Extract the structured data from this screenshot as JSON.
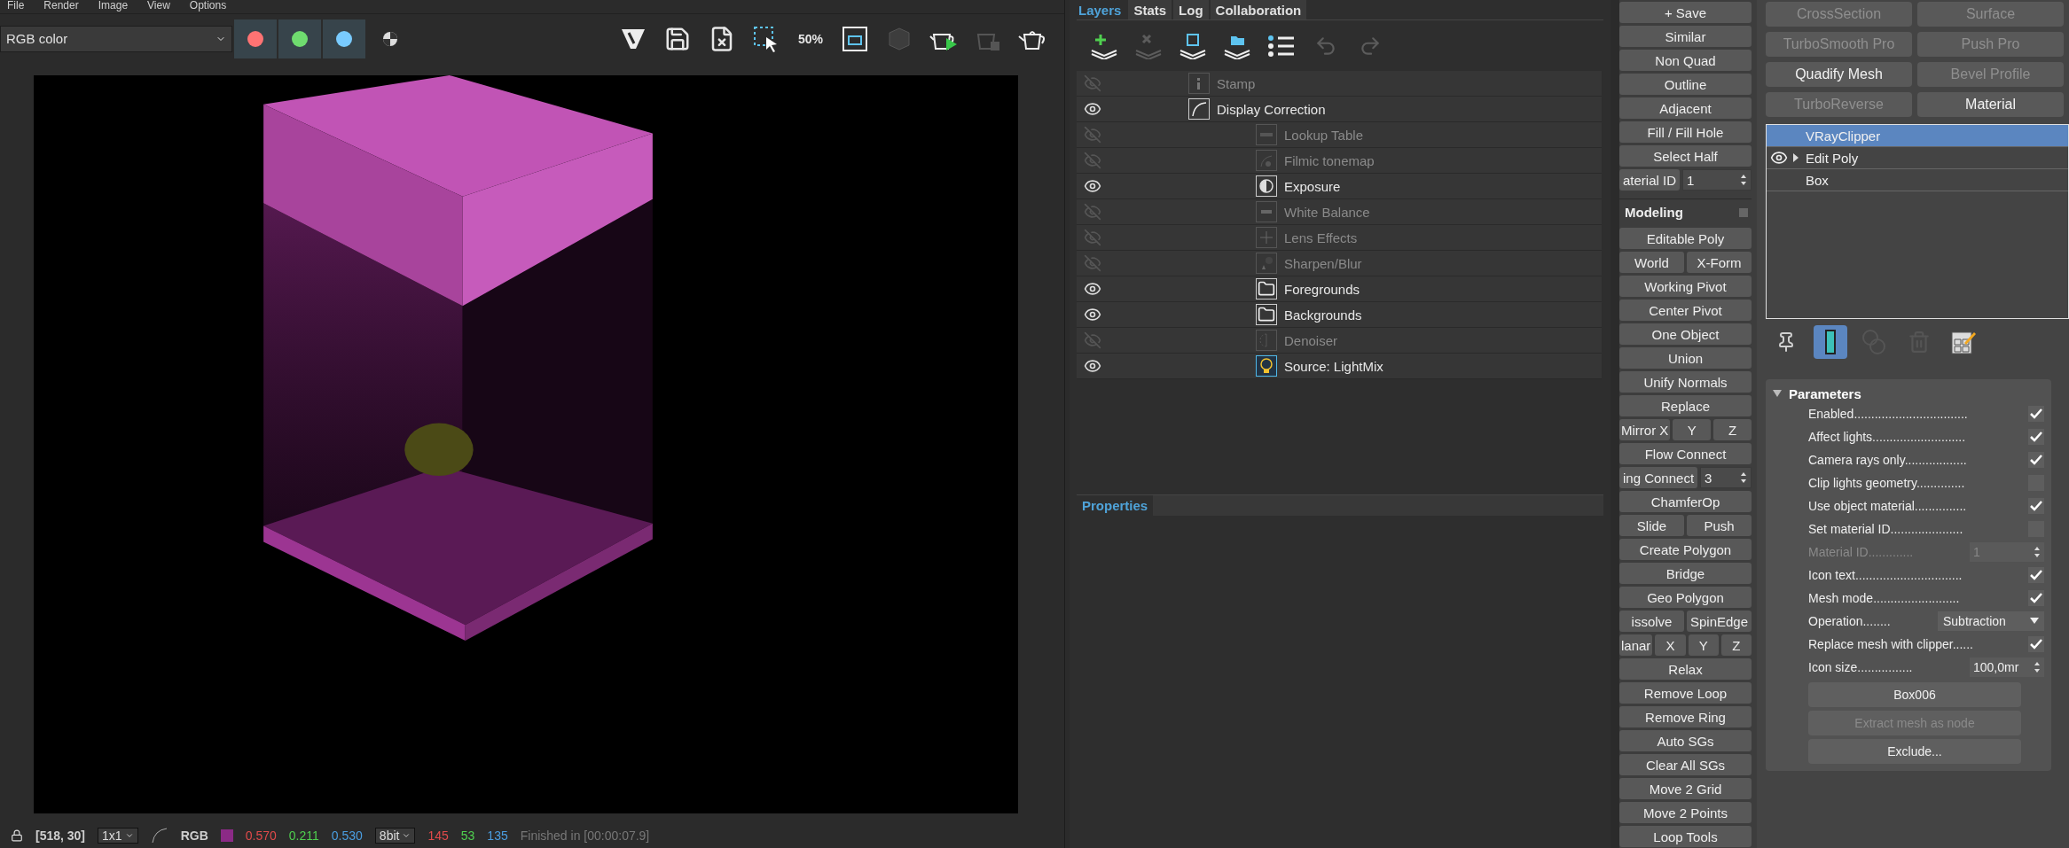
{
  "menu": [
    "File",
    "Render",
    "Image",
    "View",
    "Options"
  ],
  "vfb_toolbar": {
    "channel": "RGB color",
    "channel_buttons": [
      {
        "color": "#ff7373"
      },
      {
        "color": "#6fdc6f"
      },
      {
        "color": "#79cbff"
      }
    ],
    "zoom_label": "50%"
  },
  "status_bar": {
    "coords": "[518, 30]",
    "sampling": "1x1",
    "mode": "RGB",
    "float_values": [
      {
        "text": "0.570",
        "color": "#e04a4a"
      },
      {
        "text": "0.211",
        "color": "#4fd04f"
      },
      {
        "text": "0.530",
        "color": "#4a9de0"
      }
    ],
    "bit_depth": "8bit",
    "int_values": [
      {
        "text": "145",
        "color": "#e04a4a"
      },
      {
        "text": "53",
        "color": "#4fd04f"
      },
      {
        "text": "135",
        "color": "#4a9de0"
      }
    ],
    "message": "Finished in [00:00:07.9]"
  },
  "layers_panel": {
    "tabs": [
      {
        "label": "Layers",
        "selected": true
      },
      {
        "label": "Stats",
        "selected": false
      },
      {
        "label": "Log",
        "selected": false
      },
      {
        "label": "Collaboration",
        "selected": false
      }
    ],
    "layers": [
      {
        "label": "Stamp",
        "kind": "stamp",
        "visible": false
      },
      {
        "label": "Display Correction",
        "kind": "curve",
        "visible": true,
        "children": [
          {
            "label": "Lookup Table",
            "kind": "lut",
            "visible": false
          },
          {
            "label": "Filmic tonemap",
            "kind": "filmic",
            "visible": false
          },
          {
            "label": "Exposure",
            "kind": "exposure",
            "visible": true
          },
          {
            "label": "White Balance",
            "kind": "balance",
            "visible": false
          },
          {
            "label": "Lens Effects",
            "kind": "lens",
            "visible": false
          },
          {
            "label": "Sharpen/Blur",
            "kind": "sharpen",
            "visible": false
          },
          {
            "label": "Foregrounds",
            "kind": "folder",
            "visible": true
          },
          {
            "label": "Backgrounds",
            "kind": "folder",
            "visible": true
          },
          {
            "label": "Denoiser",
            "kind": "denoiser",
            "visible": false
          },
          {
            "label": "Source: LightMix",
            "kind": "lightmix",
            "visible": true
          }
        ]
      }
    ],
    "properties_tab": "Properties"
  },
  "tools": {
    "selection_rows": [
      [
        {
          "kind": "button",
          "label": "+ Save"
        }
      ],
      [
        {
          "kind": "button",
          "label": "Similar"
        }
      ],
      [
        {
          "kind": "button",
          "label": "Non Quad"
        }
      ],
      [
        {
          "kind": "button",
          "label": "Outline"
        }
      ],
      [
        {
          "kind": "button",
          "label": "Adjacent"
        }
      ],
      [
        {
          "kind": "button",
          "label": "Fill / Fill Hole"
        }
      ],
      [
        {
          "kind": "button",
          "label": "Select Half"
        }
      ],
      [
        {
          "kind": "spinner",
          "label": "aterial ID",
          "value": "1"
        }
      ]
    ],
    "modeling_title": "Modeling",
    "modeling_rows": [
      [
        {
          "kind": "button",
          "label": "Editable Poly"
        }
      ],
      [
        {
          "kind": "button",
          "label": "World"
        },
        {
          "kind": "button",
          "label": "X-Form"
        }
      ],
      [
        {
          "kind": "button",
          "label": "Working Pivot"
        }
      ],
      [
        {
          "kind": "button",
          "label": "Center Pivot"
        }
      ],
      [
        {
          "kind": "button",
          "label": "One Object"
        }
      ],
      [
        {
          "kind": "button",
          "label": "Union"
        }
      ],
      [
        {
          "kind": "button",
          "label": "Unify Normals"
        }
      ],
      [
        {
          "kind": "button",
          "label": "Replace"
        }
      ],
      [
        {
          "kind": "button",
          "label": "Mirror X"
        },
        {
          "kind": "button",
          "label": "Y"
        },
        {
          "kind": "button",
          "label": "Z"
        }
      ],
      [
        {
          "kind": "button",
          "label": "Flow Connect"
        }
      ],
      [
        {
          "kind": "spinner",
          "label": "ing Connect",
          "value": "3"
        }
      ],
      [
        {
          "kind": "button",
          "label": "ChamferOp"
        }
      ],
      [
        {
          "kind": "button",
          "label": "Slide"
        },
        {
          "kind": "button",
          "label": "Push"
        }
      ],
      [
        {
          "kind": "button",
          "label": "Create Polygon"
        }
      ],
      [
        {
          "kind": "button",
          "label": "Bridge"
        }
      ],
      [
        {
          "kind": "button",
          "label": "Geo Polygon"
        }
      ],
      [
        {
          "kind": "button",
          "label": "issolve"
        },
        {
          "kind": "button",
          "label": "SpinEdge"
        }
      ],
      [
        {
          "kind": "button",
          "label": "lanar"
        },
        {
          "kind": "button",
          "label": "X"
        },
        {
          "kind": "button",
          "label": "Y"
        },
        {
          "kind": "button",
          "label": "Z"
        }
      ],
      [
        {
          "kind": "button",
          "label": "Relax"
        }
      ],
      [
        {
          "kind": "button",
          "label": "Remove Loop"
        }
      ],
      [
        {
          "kind": "button",
          "label": "Remove Ring"
        }
      ],
      [
        {
          "kind": "button",
          "label": "Auto SGs"
        }
      ],
      [
        {
          "kind": "button",
          "label": "Clear All SGs"
        }
      ],
      [
        {
          "kind": "button",
          "label": "Move 2 Grid"
        }
      ],
      [
        {
          "kind": "button",
          "label": "Move 2 Points"
        }
      ],
      [
        {
          "kind": "button",
          "label": "Loop Tools"
        }
      ]
    ]
  },
  "command_panel": {
    "modifier_buttons": [
      {
        "label": "CrossSection",
        "disabled": true
      },
      {
        "label": "Surface",
        "disabled": true
      },
      {
        "label": "TurboSmooth Pro",
        "disabled": true
      },
      {
        "label": "Push Pro",
        "disabled": true
      },
      {
        "label": "Quadify Mesh",
        "disabled": false
      },
      {
        "label": "Bevel Profile",
        "disabled": true
      },
      {
        "label": "TurboReverse",
        "disabled": true
      },
      {
        "label": "Material",
        "disabled": false
      }
    ],
    "stack": [
      {
        "label": "VRayClipper",
        "selected": true
      },
      {
        "label": "Edit Poly",
        "selected": false,
        "visible": true,
        "expandable": true
      },
      {
        "label": "Box",
        "selected": false
      }
    ],
    "stack_tools": [
      {
        "kind": "pin",
        "active": false
      },
      {
        "kind": "show-end",
        "active": true
      },
      {
        "kind": "unique",
        "active": false
      },
      {
        "kind": "remove",
        "active": false
      },
      {
        "kind": "configure",
        "active": false
      }
    ],
    "parameters": {
      "title": "Parameters",
      "expanded": true,
      "rows": [
        {
          "kind": "checkbox",
          "label": "Enabled.................................",
          "checked": true,
          "disabled": false
        },
        {
          "kind": "checkbox",
          "label": "Affect lights...........................",
          "checked": true,
          "disabled": false
        },
        {
          "kind": "checkbox",
          "label": "Camera rays only..................",
          "checked": true,
          "disabled": false
        },
        {
          "kind": "checkbox",
          "label": "Clip lights geometry..............",
          "checked": false,
          "disabled": false
        },
        {
          "kind": "checkbox",
          "label": "Use object material...............",
          "checked": true,
          "disabled": false
        },
        {
          "kind": "checkbox",
          "label": "Set material ID.....................",
          "checked": false,
          "disabled": false
        },
        {
          "kind": "spinner",
          "label": "Material ID.............",
          "value": "1",
          "disabled": true
        },
        {
          "kind": "checkbox",
          "label": "Icon text...............................",
          "checked": true,
          "disabled": false
        },
        {
          "kind": "checkbox",
          "label": "Mesh mode.........................",
          "checked": true,
          "disabled": false
        },
        {
          "kind": "dropdown",
          "label": "Operation........",
          "value": "Subtraction",
          "disabled": false
        },
        {
          "kind": "checkbox",
          "label": "Replace mesh with clipper......",
          "checked": true,
          "disabled": false
        },
        {
          "kind": "spinner",
          "label": "Icon size................",
          "value": "100,0mr",
          "disabled": false
        }
      ],
      "buttons": [
        {
          "label": "Box006",
          "disabled": false
        },
        {
          "label": "Extract mesh as node",
          "disabled": true
        },
        {
          "label": "Exclude...",
          "disabled": false
        }
      ]
    }
  }
}
